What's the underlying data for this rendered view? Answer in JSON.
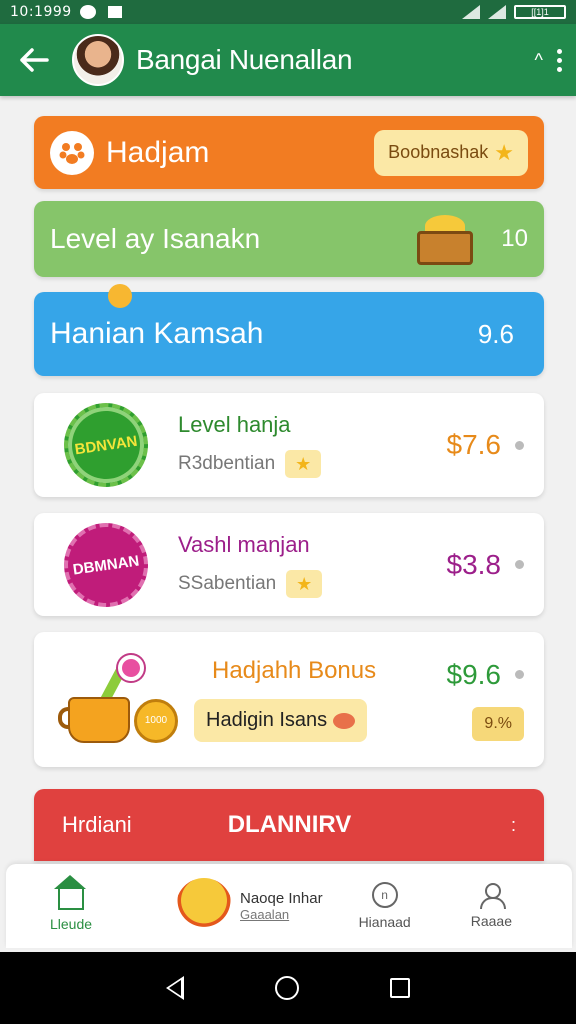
{
  "status_bar": {
    "time": "10:1999",
    "battery": "[[1]1"
  },
  "app_bar": {
    "title": "Bangai Nuenallan"
  },
  "banners": [
    {
      "title": "Hadjam",
      "pill": "Boobnashak"
    },
    {
      "title": "Level ay Isanakn",
      "value": "10"
    },
    {
      "title": "Hanian Kamsah",
      "value": "9.6"
    }
  ],
  "panels": [
    {
      "badge": "BDNVAN",
      "title": "Level hanja",
      "subtitle": "R3dbentian",
      "value": "$7.6",
      "color": "#e78a1a"
    },
    {
      "badge": "DBMNAN",
      "title": "Vashl manjan",
      "subtitle": "SSabentian",
      "value": "$3.8",
      "color": "#9c1f8a"
    }
  ],
  "bonus": {
    "title": "Hadjahh Bonus",
    "coin": "1000",
    "pill": "Hadigin Isans",
    "value": "$9.6",
    "percent": "9.%"
  },
  "red_bar": {
    "left": "Hrdiani",
    "center": "DLANNIRV",
    "right": ":"
  },
  "bottom_nav": {
    "home": "Lleude",
    "mascot_title": "Naoqe Inhar",
    "mascot_sub": "Gaaalan",
    "item3_icon": "n",
    "item3": "Hianaad",
    "item4": "Raaae"
  },
  "colors": {
    "app_bar": "#218a4c",
    "orange": "#f27c22",
    "green": "#86c56a",
    "blue": "#36a5e8",
    "red": "#e0413f"
  }
}
